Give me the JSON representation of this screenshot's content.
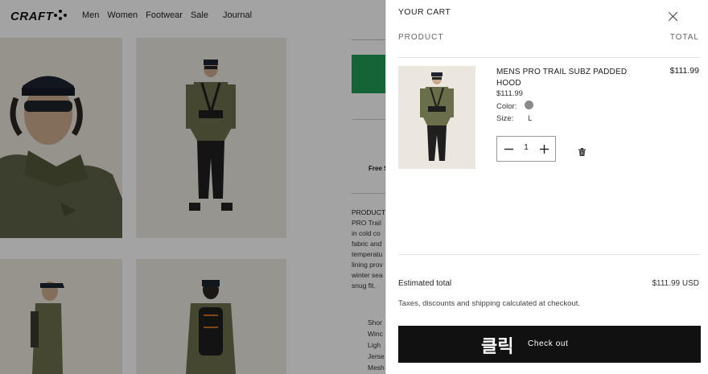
{
  "brand": {
    "logo": "CRAFT"
  },
  "nav": {
    "items": [
      "Men",
      "Women",
      "Footwear",
      "Sale",
      "Journal"
    ]
  },
  "product_page": {
    "free_shipping_text": "Free S",
    "description_heading": "PRODUCT",
    "description_lines": [
      "PRO Trail",
      "in cold co",
      "fabric and",
      "temperatu",
      "lining prov",
      "winter sea",
      "snug fit."
    ],
    "bullets": [
      "Shor",
      "Winc",
      "Ligh",
      "Jerse",
      "Mesh"
    ]
  },
  "cart": {
    "title": "YOUR CART",
    "column_product": "PRODUCT",
    "column_total": "TOTAL",
    "item": {
      "name": "MENS PRO TRAIL SUBZ PADDED HOOD",
      "price": "$111.99",
      "color_label": "Color:",
      "color_hex": "#8a8a8a",
      "size_label": "Size:",
      "size_value": "L",
      "quantity": "1",
      "line_total": "$111.99"
    },
    "estimated_total_label": "Estimated total",
    "estimated_total_value": "$111.99 USD",
    "taxes_note": "Taxes, discounts and shipping calculated at checkout.",
    "checkout_korean": "클릭",
    "checkout_label": "Check out"
  },
  "colors": {
    "accent_green": "#1f9a55",
    "checkout_bg": "#111111"
  },
  "icons": [
    "close-icon",
    "minus-icon",
    "plus-icon",
    "trash-icon"
  ]
}
